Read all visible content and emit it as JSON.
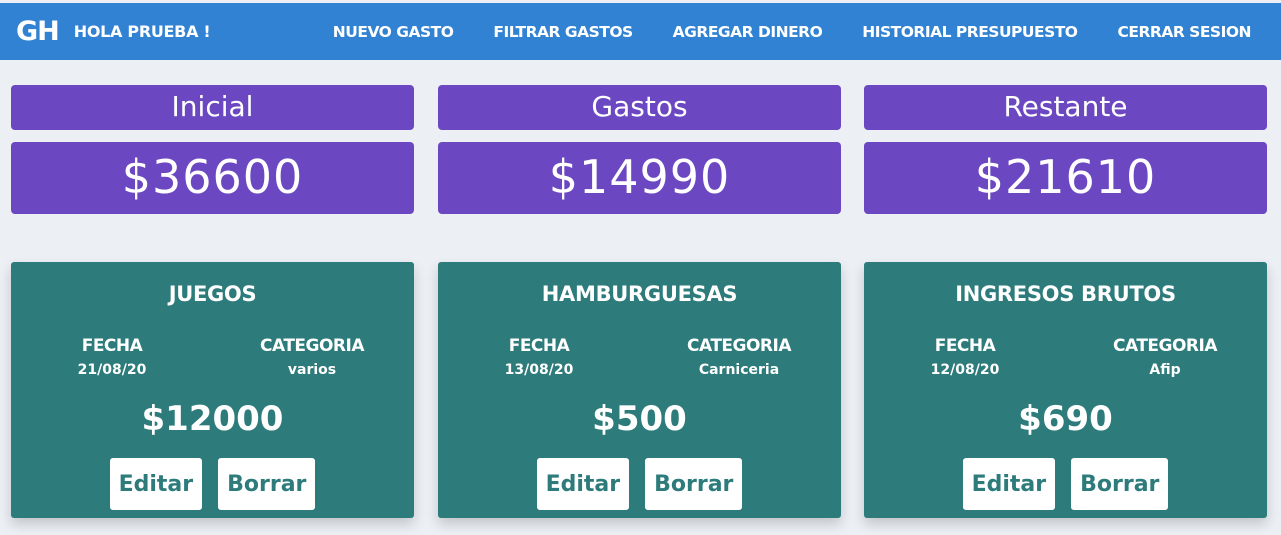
{
  "navbar": {
    "brand": "GH",
    "greeting": "HOLA PRUEBA !",
    "links": [
      "NUEVO GASTO",
      "FILTRAR GASTOS",
      "AGREGAR DINERO",
      "HISTORIAL PRESUPUESTO",
      "CERRAR SESION"
    ]
  },
  "summary": [
    {
      "label": "Inicial",
      "value": "$36600"
    },
    {
      "label": "Gastos",
      "value": "$14990"
    },
    {
      "label": "Restante",
      "value": "$21610"
    }
  ],
  "expenses": [
    {
      "title": "JUEGOS",
      "fecha_label": "FECHA",
      "fecha": "21/08/20",
      "categoria_label": "CATEGORIA",
      "categoria": "varios",
      "amount": "$12000",
      "edit_label": "Editar",
      "delete_label": "Borrar"
    },
    {
      "title": "HAMBURGUESAS",
      "fecha_label": "FECHA",
      "fecha": "13/08/20",
      "categoria_label": "CATEGORIA",
      "categoria": "Carniceria",
      "amount": "$500",
      "edit_label": "Editar",
      "delete_label": "Borrar"
    },
    {
      "title": "INGRESOS BRUTOS",
      "fecha_label": "FECHA",
      "fecha": "12/08/20",
      "categoria_label": "CATEGORIA",
      "categoria": "Afip",
      "amount": "$690",
      "edit_label": "Editar",
      "delete_label": "Borrar"
    }
  ],
  "colors": {
    "navbar": "#3282d3",
    "summary": "#6c47c2",
    "card": "#2d7b7b",
    "background": "#ecf0f5"
  }
}
